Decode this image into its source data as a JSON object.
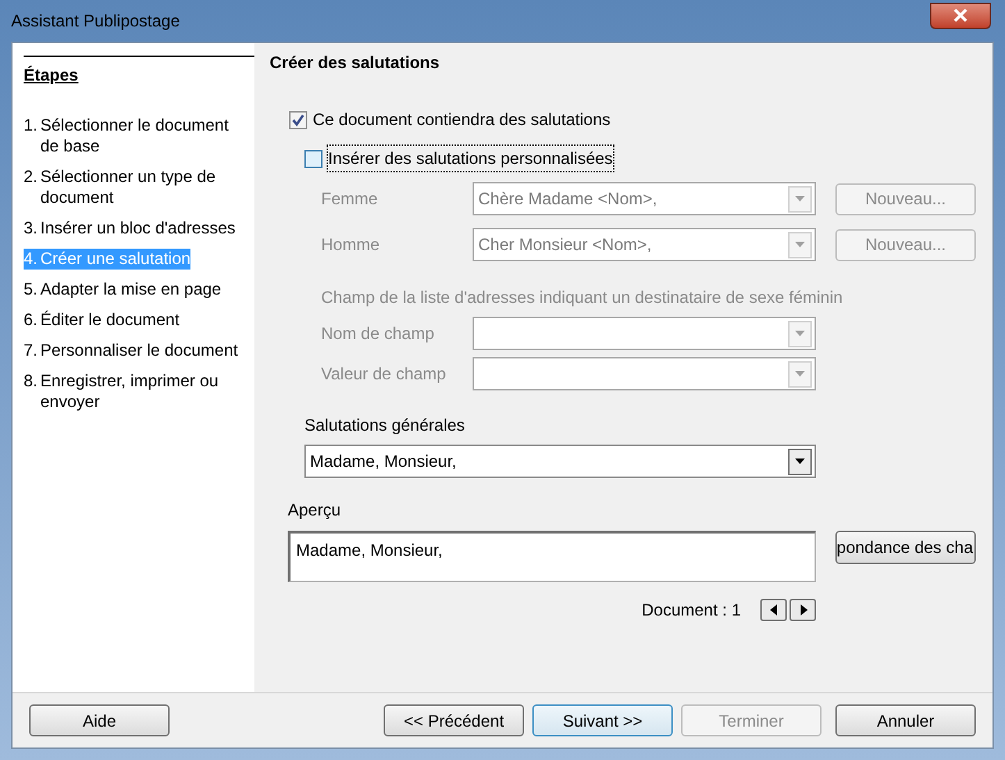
{
  "window": {
    "title": "Assistant Publipostage"
  },
  "steps": {
    "heading": "Étapes",
    "items": [
      {
        "number": "1.",
        "label": "Sélectionner le document de base",
        "selected": false
      },
      {
        "number": "2.",
        "label": "Sélectionner un type de document",
        "selected": false
      },
      {
        "number": "3.",
        "label": "Insérer un bloc d'adresses",
        "selected": false
      },
      {
        "number": "4.",
        "label": "Créer une salutation",
        "selected": true
      },
      {
        "number": "5.",
        "label": "Adapter la mise en page",
        "selected": false
      },
      {
        "number": "6.",
        "label": "Éditer le document",
        "selected": false
      },
      {
        "number": "7.",
        "label": "Personnaliser le document",
        "selected": false
      },
      {
        "number": "8.",
        "label": "Enregistrer, imprimer ou envoyer",
        "selected": false
      }
    ]
  },
  "page": {
    "title": "Créer des salutations",
    "contains_salutation": {
      "label": "Ce document contiendra des salutations",
      "checked": true
    },
    "personalized": {
      "label": "Insérer des salutations personnalisées",
      "checked": false
    },
    "gender_rows": [
      {
        "label": "Femme",
        "value": "Chère Madame <Nom>,",
        "button": "Nouveau...",
        "disabled": true
      },
      {
        "label": "Homme",
        "value": "Cher Monsieur <Nom>,",
        "button": "Nouveau...",
        "disabled": true
      }
    ],
    "field_note": "Champ de la liste d'adresses indiquant un destinataire de sexe féminin",
    "field_rows": [
      {
        "label": "Nom de champ",
        "disabled": true
      },
      {
        "label": "Valeur de champ",
        "disabled": true
      }
    ],
    "general": {
      "label": "Salutations générales",
      "value": "Madame, Monsieur,"
    },
    "preview": {
      "label": "Aperçu",
      "text": "Madame, Monsieur,",
      "button": "pondance des cha"
    },
    "document_counter": "Document : 1"
  },
  "buttons": [
    {
      "label": "Aide",
      "kind": "left",
      "disabled": false,
      "focused": false
    },
    {
      "label": "<< Précédent",
      "kind": "right",
      "disabled": false,
      "focused": false
    },
    {
      "label": "Suivant >>",
      "kind": "right",
      "disabled": false,
      "focused": true
    },
    {
      "label": "Terminer",
      "kind": "right",
      "disabled": true,
      "focused": false
    },
    {
      "label": "Annuler",
      "kind": "right",
      "disabled": false,
      "focused": false
    }
  ]
}
